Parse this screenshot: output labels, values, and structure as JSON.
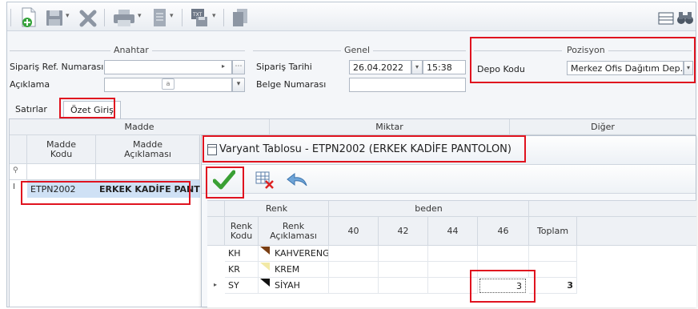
{
  "toolbar": {
    "icons": [
      "new-document-icon",
      "save-icon",
      "delete-icon",
      "print-icon",
      "report-icon",
      "export-icon",
      "copy-icon",
      "calculator-icon",
      "binoculars-icon"
    ]
  },
  "groups": {
    "anahtar": "Anahtar",
    "genel": "Genel",
    "pozisyon": "Pozisyon"
  },
  "fields": {
    "siparis_ref_label": "Sipariş Ref. Numarası",
    "aciklama_label": "Açıklama",
    "siparis_tarihi_label": "Sipariş Tarihi",
    "siparis_tarihi_value": "26.04.2022",
    "siparis_saati_value": "15:38",
    "belge_numarasi_label": "Belge Numarası",
    "depo_kodu_label": "Depo Kodu",
    "depo_kodu_value": "Merkez Ofis Dağıtım Dep..."
  },
  "tabs": [
    {
      "label": "Satırlar"
    },
    {
      "label": "Özet Giriş"
    }
  ],
  "grid": {
    "band_madde": "Madde",
    "band_miktar": "Miktar",
    "band_diger": "Diğer",
    "col_madde_kodu": "Madde\nKodu",
    "col_madde_aciklamasi": "Madde\nAçıklaması",
    "row": {
      "code": "ETPN2002",
      "name": "ERKEK KADİFE PANTOLON"
    }
  },
  "variant": {
    "title": "Varyant Tablosu - ETPN2002 (ERKEK KADİFE PANTOLON)",
    "band_renk": "Renk",
    "band_beden": "beden",
    "col_renk_kodu": "Renk\nKodu",
    "col_renk_aciklamasi": "Renk\nAçıklaması",
    "sizes": [
      "40",
      "42",
      "44",
      "46"
    ],
    "col_toplam": "Toplam",
    "rows": [
      {
        "code": "KH",
        "name": "KAHVERENGİ",
        "swatch": "#7a3e12",
        "qty46": "",
        "total": ""
      },
      {
        "code": "KR",
        "name": "KREM",
        "swatch": "#f2e9a6",
        "qty46": "",
        "total": ""
      },
      {
        "code": "SY",
        "name": "SİYAH",
        "swatch": "#111111",
        "qty46": "3",
        "total": "3"
      }
    ]
  },
  "colors": {
    "highlight_red": "#e0131f",
    "selected_row": "#cfe1f5"
  }
}
